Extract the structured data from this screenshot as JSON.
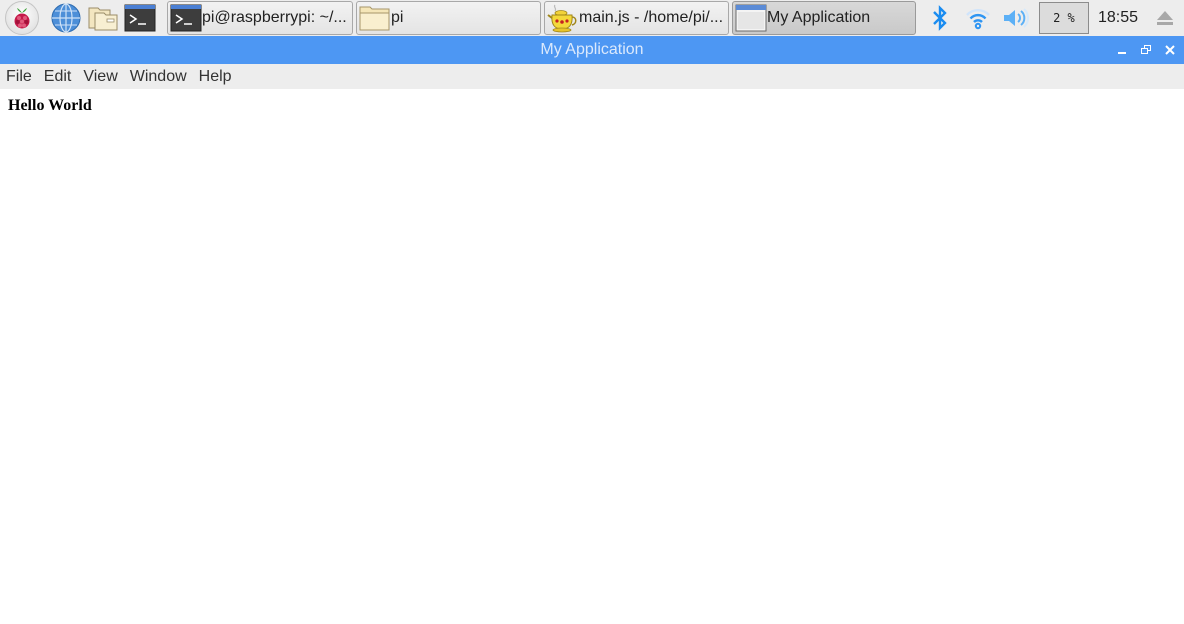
{
  "taskbar": {
    "launchers": [
      {
        "name": "raspberry-menu",
        "icon": "raspberry-icon"
      },
      {
        "name": "web-browser",
        "icon": "globe-icon"
      },
      {
        "name": "file-manager",
        "icon": "folder-icon"
      },
      {
        "name": "terminal",
        "icon": "terminal-icon"
      }
    ],
    "tasks": [
      {
        "label": "pi@raspberrypi: ~/...",
        "icon": "terminal-icon",
        "active": false
      },
      {
        "label": "pi",
        "icon": "folder-icon",
        "active": false
      },
      {
        "label": "main.js - /home/pi/...",
        "icon": "geany-teapot-icon",
        "active": false
      },
      {
        "label": "My Application",
        "icon": "window-icon",
        "active": true
      }
    ],
    "tray": {
      "bluetooth_icon": "bluetooth-icon",
      "wifi_icon": "wifi-icon",
      "volume_icon": "volume-icon",
      "cpu_usage": "2 %",
      "clock": "18:55",
      "eject_icon": "eject-icon"
    },
    "colors": {
      "tray_accent": "#1a8cf0"
    }
  },
  "window": {
    "title": "My Application",
    "controls": {
      "minimize": "minimize",
      "restore": "restore",
      "close": "close"
    },
    "colors": {
      "titlebar": "#4d97f3",
      "title_text": "#dbe9fc"
    }
  },
  "menubar": {
    "items": [
      "File",
      "Edit",
      "View",
      "Window",
      "Help"
    ]
  },
  "content": {
    "heading": "Hello World"
  }
}
